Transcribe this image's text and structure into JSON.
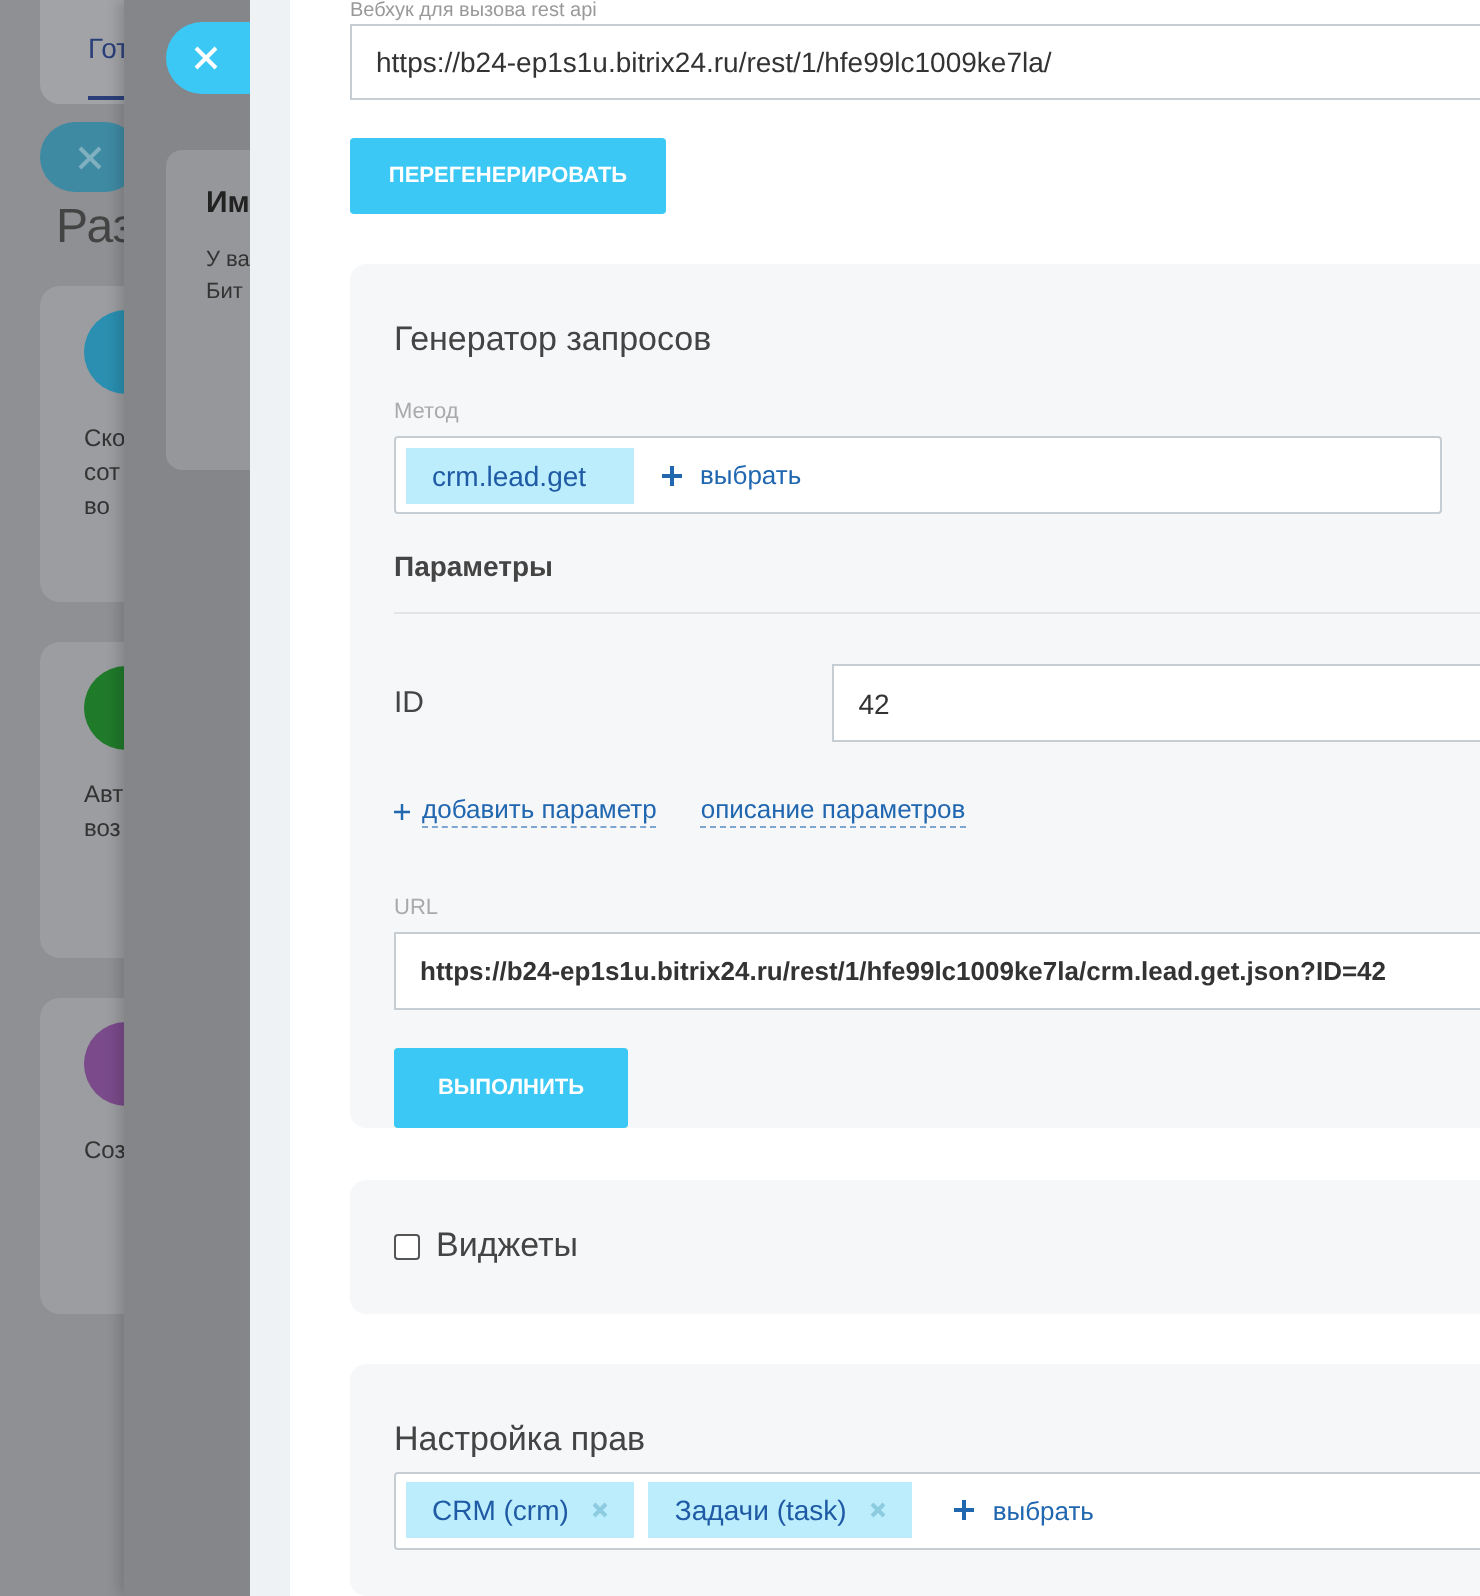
{
  "background_page": {
    "tab": "Гот",
    "heading": "Раз",
    "cards": [
      {
        "color": "#2a8fb0",
        "lines": [
          "Ско",
          "сот",
          "во"
        ]
      },
      {
        "color": "#1f7a2a",
        "lines": [
          "Авт",
          "воз"
        ]
      },
      {
        "color": "#7a4a8a",
        "lines": [
          "Соз"
        ]
      }
    ]
  },
  "dialog_behind": {
    "title": "Им",
    "lines": [
      "У ва",
      "Бит"
    ]
  },
  "webhook": {
    "label": "Вебхук для вызова rest api",
    "value": "https://b24-ep1s1u.bitrix24.ru/rest/1/hfe99lc1009ke7la/",
    "button": "ПЕРЕГЕНЕРИРОВАТЬ"
  },
  "generator": {
    "title": "Генератор запросов",
    "method_label": "Метод",
    "method_chip": "crm.lead.get",
    "method_add": "выбрать",
    "params_title": "Параметры",
    "params": [
      {
        "name": "ID",
        "value": "42"
      }
    ],
    "add_param": "добавить параметр",
    "params_help": "описание параметров",
    "url_label": "URL",
    "url": "https://b24-ep1s1u.bitrix24.ru/rest/1/hfe99lc1009ke7la/crm.lead.get.json?ID=42",
    "run_button": "ВЫПОЛНИТЬ"
  },
  "widgets": {
    "label": "Виджеты",
    "checked": false
  },
  "rights": {
    "title": "Настройка прав",
    "chips": [
      "CRM (crm)",
      "Задачи (task)"
    ],
    "add": "выбрать"
  }
}
